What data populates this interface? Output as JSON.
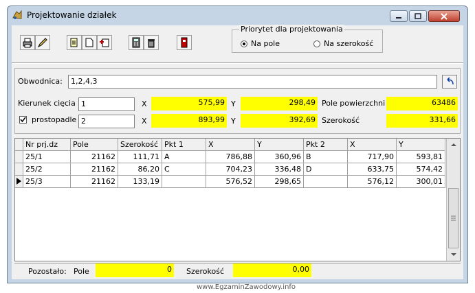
{
  "window": {
    "title": "Projektowanie działek"
  },
  "priority": {
    "legend": "Priorytet dla projektowania",
    "opt_area": "Na pole",
    "opt_width": "Na szerokość",
    "selected": "Na pole"
  },
  "bypass": {
    "label": "Obwodnica:",
    "value": "1,2,4,3"
  },
  "cut": {
    "label": "Kierunek cięcia",
    "value1": "1",
    "x1": "575,99",
    "y1": "298,49",
    "perpendicular_label": "prostopadle",
    "perpendicular_checked": true,
    "value2": "2",
    "x2": "893,99",
    "y2": "392,69",
    "x_label": "X",
    "y_label": "Y"
  },
  "area": {
    "label": "Pole powierzchni",
    "value": "63486"
  },
  "width": {
    "label": "Szerokość",
    "value": "331,66"
  },
  "table": {
    "columns": [
      "Nr prj.dz",
      "Pole",
      "Szerokość",
      "Pkt 1",
      "X",
      "Y",
      "Pkt 2",
      "X",
      "Y"
    ],
    "rows": [
      [
        "25/1",
        "21162",
        "111,71",
        "A",
        "786,88",
        "360,96",
        "B",
        "717,90",
        "593,81"
      ],
      [
        "25/2",
        "21162",
        "86,20",
        "C",
        "704,23",
        "336,48",
        "D",
        "633,75",
        "574,42"
      ],
      [
        "25/3",
        "21162",
        "133,19",
        "",
        "576,52",
        "298,65",
        "",
        "576,12",
        "300,01"
      ]
    ],
    "current_row": 2
  },
  "remaining": {
    "label": "Pozostało:",
    "area_label": "Pole",
    "area_value": "0",
    "width_label": "Szerokość",
    "width_value": "0,00"
  },
  "watermark": "www.EgzaminZawodowy.info",
  "colors": {
    "highlight": "#ffff00",
    "window_frame": "#c6d5e6"
  }
}
